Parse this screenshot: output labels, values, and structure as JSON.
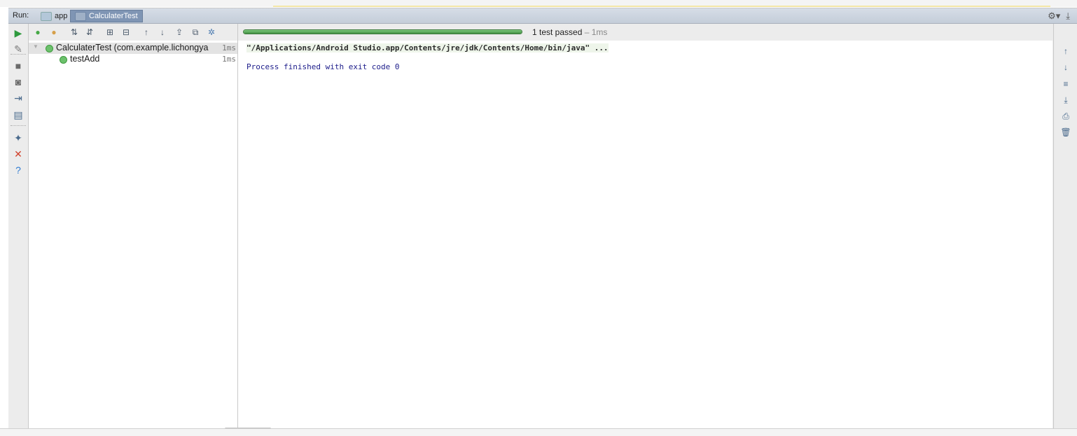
{
  "header": {
    "run_label": "Run:"
  },
  "tabs": [
    {
      "label": "app",
      "active": false
    },
    {
      "label": "CalculaterTest",
      "active": true
    }
  ],
  "left_toolbar": {
    "items": [
      {
        "name": "rerun-icon",
        "glyph": "▶",
        "color": "#2e9a3e"
      },
      {
        "name": "debug-icon",
        "glyph": "✎",
        "color": "#7a7a7a"
      },
      {
        "name": "stop-icon",
        "glyph": "■",
        "color": "#6a6a6a"
      },
      {
        "name": "camera-icon",
        "glyph": "◙",
        "color": "#6a6a6a"
      },
      {
        "name": "login-icon",
        "glyph": "⇥",
        "color": "#4a6a8c"
      },
      {
        "name": "layout-icon",
        "glyph": "▤",
        "color": "#4a6a8c"
      },
      {
        "name": "pin-icon",
        "glyph": "✦",
        "color": "#4a6a8c"
      },
      {
        "name": "close-icon",
        "glyph": "✕",
        "color": "#d0402b"
      },
      {
        "name": "help-icon",
        "glyph": "?",
        "color": "#2f7bd1"
      }
    ]
  },
  "tree_toolbar": {
    "items": [
      {
        "name": "show-passed-icon",
        "glyph": "●",
        "color": "#45a845"
      },
      {
        "name": "show-ignored-icon",
        "glyph": "●",
        "color": "#d6a04a"
      },
      {
        "name": "sort-alpha-icon",
        "glyph": "⇅",
        "color": "#4b5a6b"
      },
      {
        "name": "sort-duration-icon",
        "glyph": "⇵",
        "color": "#4b5a6b"
      },
      {
        "name": "expand-all-icon",
        "glyph": "⊞",
        "color": "#4b5a6b"
      },
      {
        "name": "collapse-all-icon",
        "glyph": "⊟",
        "color": "#4b5a6b"
      },
      {
        "name": "prev-failed-icon",
        "glyph": "↑",
        "color": "#4b5a6b"
      },
      {
        "name": "next-failed-icon",
        "glyph": "↓",
        "color": "#4b5a6b"
      },
      {
        "name": "export-icon",
        "glyph": "⇪",
        "color": "#4b5a6b"
      },
      {
        "name": "import-icon",
        "glyph": "⧉",
        "color": "#4b5a6b"
      },
      {
        "name": "settings-icon",
        "glyph": "✲",
        "color": "#4a7ab0"
      }
    ]
  },
  "test_tree": {
    "root": {
      "name": "CalculaterTest (com.example.lichongya",
      "time": "1ms",
      "status": "passed"
    },
    "children": [
      {
        "name": "testAdd",
        "time": "1ms",
        "status": "passed"
      }
    ]
  },
  "progress": {
    "value": 1.0,
    "color": "#4b9a4b"
  },
  "status": {
    "summary": "1 test passed",
    "separator": " – ",
    "duration": "1ms"
  },
  "console": {
    "lines": [
      "\"/Applications/Android Studio.app/Contents/jre/jdk/Contents/Home/bin/java\" ...",
      "Process finished with exit code 0"
    ]
  },
  "right_toolbar": {
    "items": [
      {
        "name": "scroll-up-icon",
        "glyph": "↑"
      },
      {
        "name": "scroll-down-icon",
        "glyph": "↓"
      },
      {
        "name": "soft-wrap-icon",
        "glyph": "≡"
      },
      {
        "name": "scroll-to-end-icon",
        "glyph": "⤓"
      },
      {
        "name": "print-icon",
        "glyph": "⎙"
      },
      {
        "name": "trash-icon",
        "glyph": "🗑"
      }
    ]
  }
}
